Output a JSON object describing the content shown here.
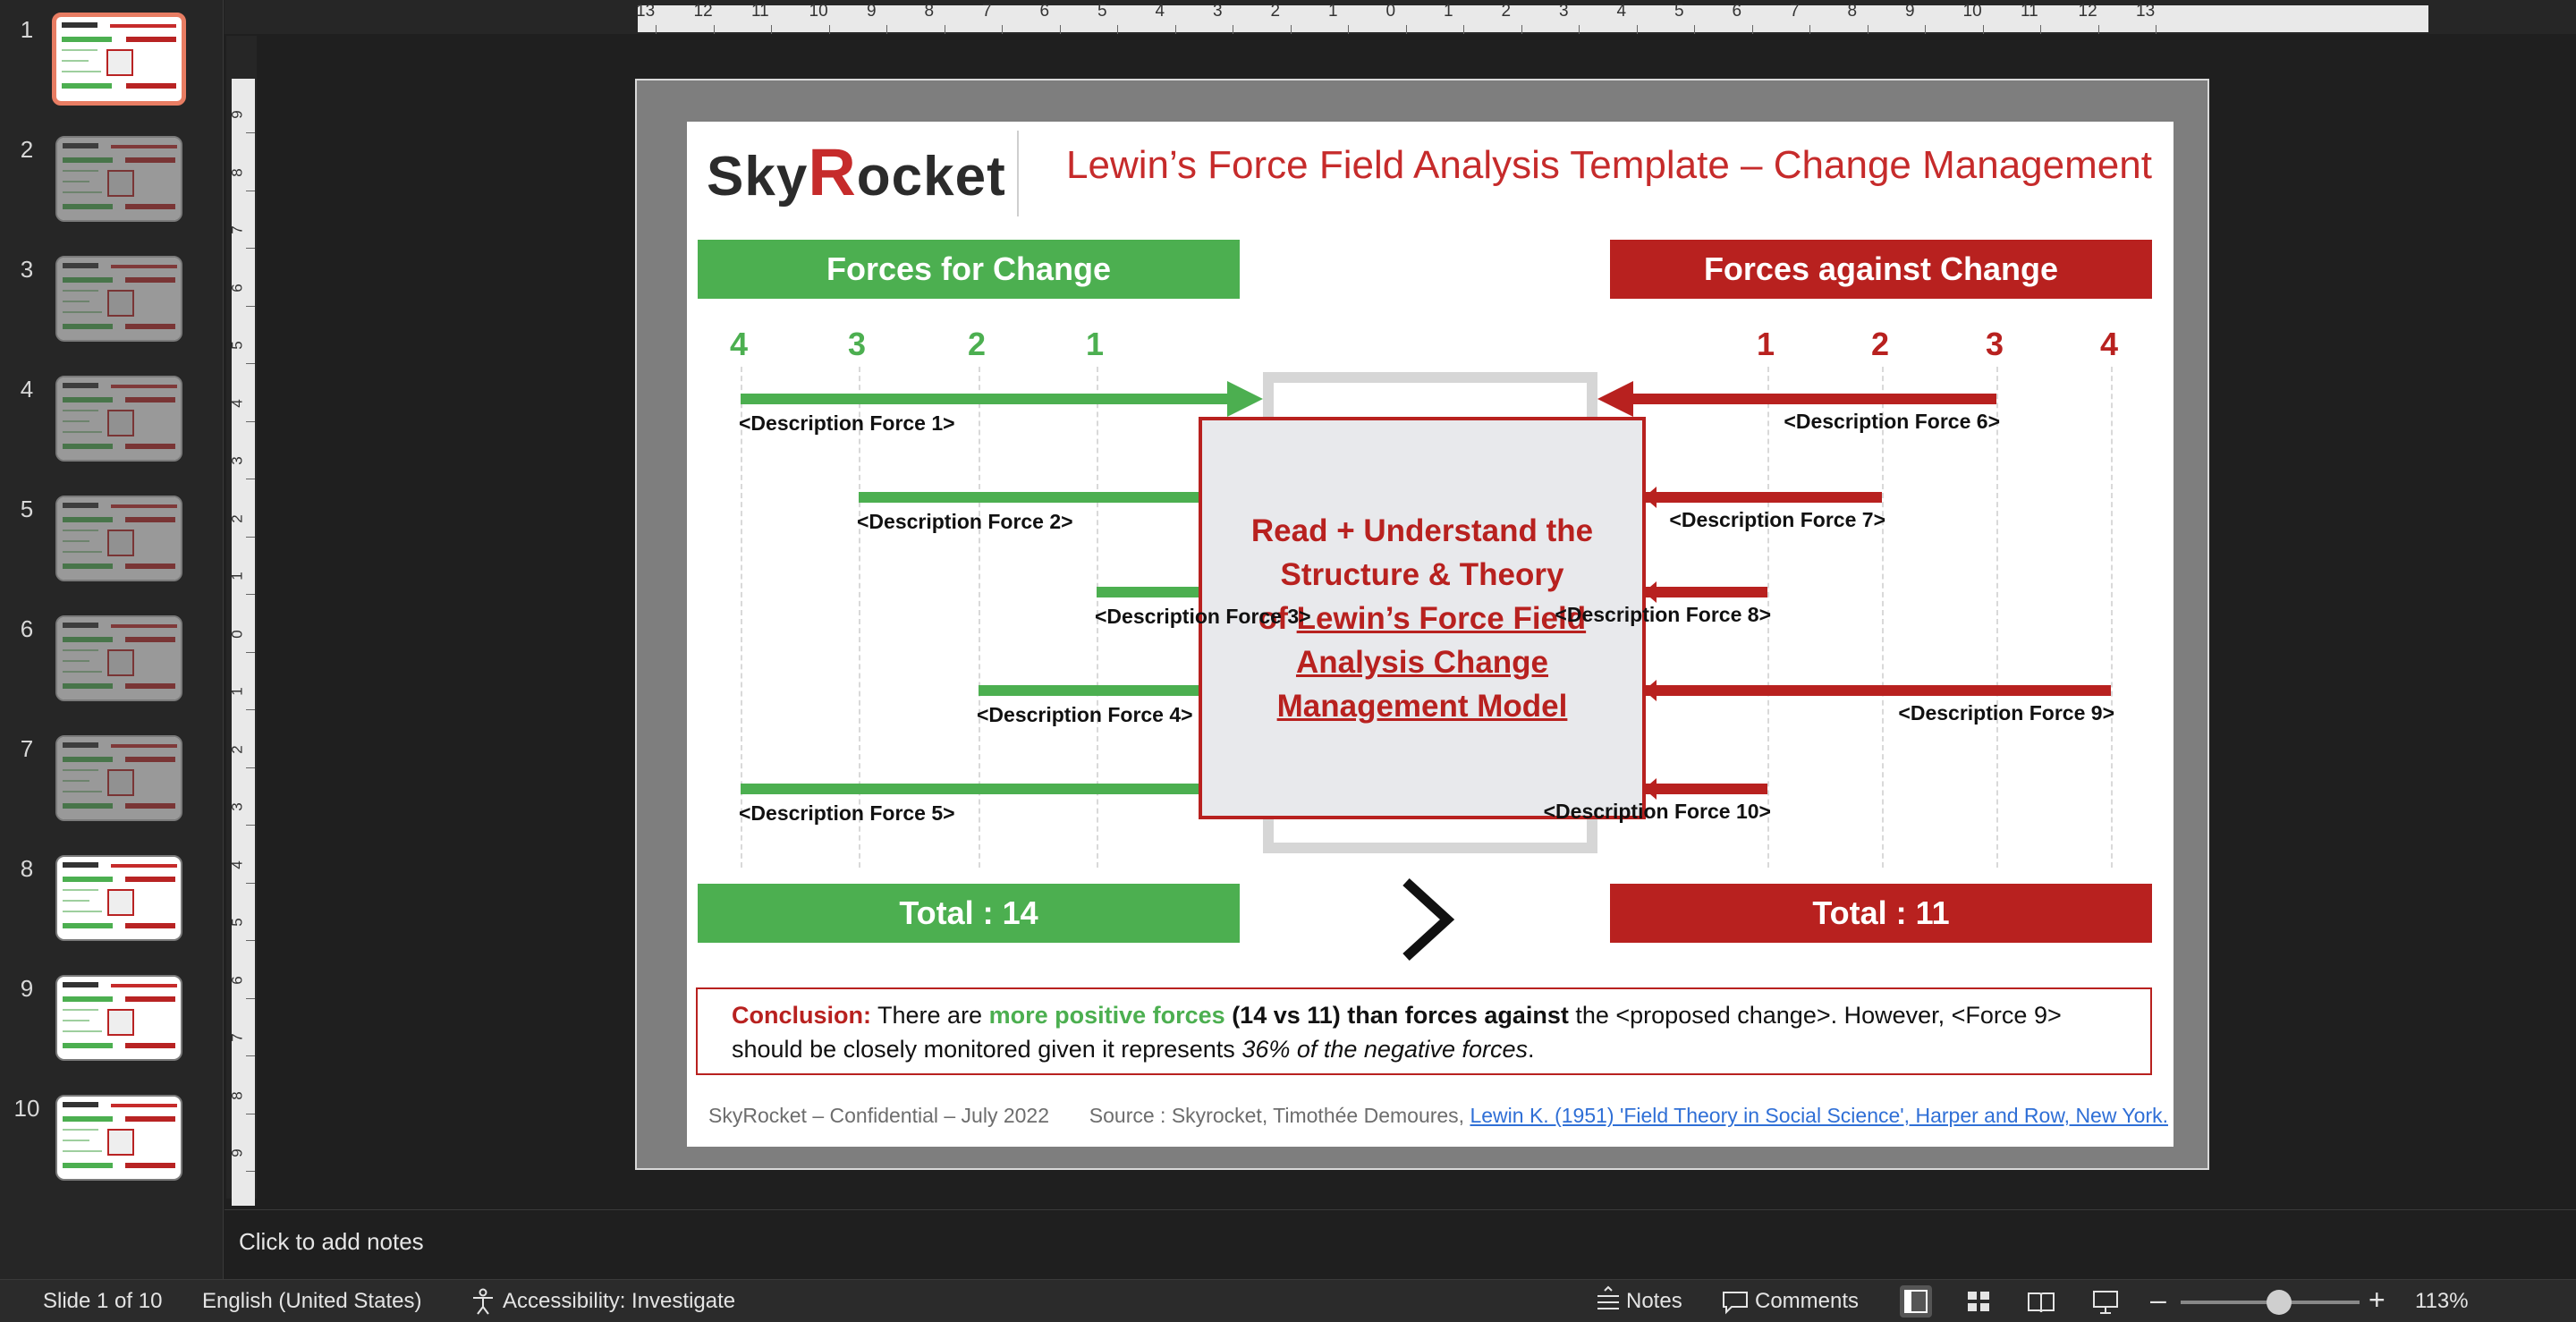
{
  "thumbnails": [
    {
      "num": "1"
    },
    {
      "num": "2"
    },
    {
      "num": "3"
    },
    {
      "num": "4"
    },
    {
      "num": "5"
    },
    {
      "num": "6"
    },
    {
      "num": "7"
    },
    {
      "num": "8"
    },
    {
      "num": "9"
    },
    {
      "num": "10"
    }
  ],
  "ruler": {
    "horizontal": [
      "13",
      "12",
      "11",
      "10",
      "9",
      "8",
      "7",
      "6",
      "5",
      "4",
      "3",
      "2",
      "1",
      "0",
      "1",
      "2",
      "3",
      "4",
      "5",
      "6",
      "7",
      "8",
      "9",
      "10",
      "11",
      "12",
      "13"
    ],
    "vertical": [
      "9",
      "8",
      "7",
      "6",
      "5",
      "4",
      "3",
      "2",
      "1",
      "0",
      "1",
      "2",
      "3",
      "4",
      "5",
      "6",
      "7",
      "8",
      "9"
    ]
  },
  "slide": {
    "logo_a": "Sky",
    "logo_r": "R",
    "logo_b": "ocket",
    "title": "Lewin’s Force Field Analysis Template – Change Management",
    "for_header": "Forces for Change",
    "against_header": "Forces against Change",
    "scale_for": [
      "4",
      "3",
      "2",
      "1"
    ],
    "scale_against": [
      "1",
      "2",
      "3",
      "4"
    ],
    "forces_for": [
      {
        "label": "<Description Force 1>",
        "strength": 4
      },
      {
        "label": "<Description Force 2>",
        "strength": 3
      },
      {
        "label": "<Description Force 3>",
        "strength": 1
      },
      {
        "label": "<Description Force 4>",
        "strength": 2
      },
      {
        "label": "<Description Force 5>",
        "strength": 4
      }
    ],
    "forces_against": [
      {
        "label": "<Description Force 6>",
        "strength": 3
      },
      {
        "label": "<Description Force 7>",
        "strength": 2
      },
      {
        "label": "<Description Force 8>",
        "strength": 1
      },
      {
        "label": "<Description Force 9>",
        "strength": 4
      },
      {
        "label": "<Description Force 10>",
        "strength": 1
      }
    ],
    "center_line1": "Read + Understand the",
    "center_line2": "Structure & Theory",
    "center_line3_a": "of ",
    "center_line3_b": "Lewin’s Force Field",
    "center_line4": "Analysis Change",
    "center_line5": "Management Model",
    "total_for": "Total : 14",
    "total_against": "Total : 11",
    "conclusion_label": "Conclusion:",
    "conclusion_t1": " There are ",
    "conclusion_pos": "more positive forces",
    "conclusion_t2": " ",
    "conclusion_bold1": "(14 vs 11)",
    "conclusion_t3": " ",
    "conclusion_bold2": "than forces against",
    "conclusion_t4": " the <proposed change>. However, <Force 9>",
    "conclusion_t5": "should be closely monitored given it represents ",
    "conclusion_ital": "36% of the negative forces",
    "conclusion_t6": ".",
    "footer_left": "SkyRocket – Confidential – July 2022",
    "footer_source": "Source : Skyrocket, Timothée Demoures, ",
    "footer_link": "Lewin K. (1951) 'Field Theory in Social Science', Harper and Row, New York."
  },
  "notes_placeholder": "Click to add notes",
  "status": {
    "slide": "Slide 1 of 10",
    "language": "English (United States)",
    "accessibility": "Accessibility: Investigate",
    "notes": "Notes",
    "comments": "Comments",
    "zoom": "113%",
    "zoom_fraction": 0.55
  },
  "colors": {
    "green": "#4caf50",
    "red": "#b8211f",
    "accent_selected": "#e87d63"
  }
}
